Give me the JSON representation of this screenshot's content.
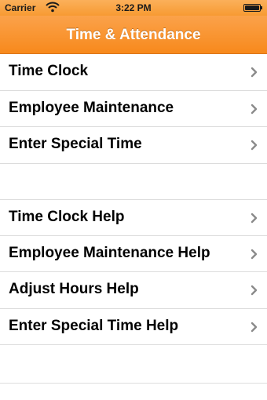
{
  "status_bar": {
    "carrier": "Carrier",
    "time": "3:22 PM"
  },
  "nav": {
    "title": "Time & Attendance"
  },
  "menu_main": [
    {
      "label": "Time Clock"
    },
    {
      "label": "Employee Maintenance"
    },
    {
      "label": "Enter Special Time"
    }
  ],
  "menu_help": [
    {
      "label": "Time Clock Help"
    },
    {
      "label": "Employee Maintenance Help"
    },
    {
      "label": "Adjust Hours Help"
    },
    {
      "label": "Enter Special Time Help"
    }
  ],
  "colors": {
    "nav_orange": "#f7891c",
    "chevron": "#8a8a8a"
  }
}
